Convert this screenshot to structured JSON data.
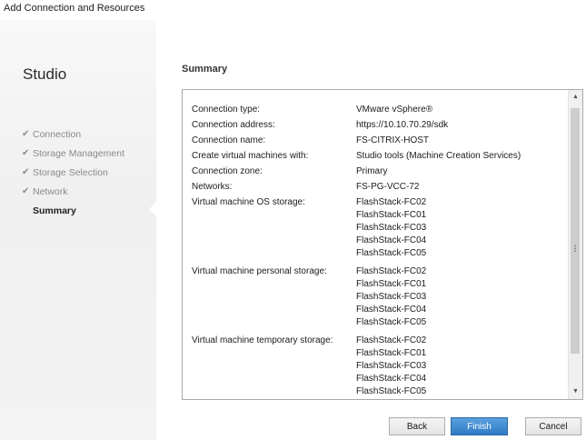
{
  "window": {
    "title": "Add Connection and Resources"
  },
  "sidebar": {
    "app_name": "Studio",
    "steps": [
      {
        "label": "Connection",
        "done": true
      },
      {
        "label": "Storage Management",
        "done": true
      },
      {
        "label": "Storage Selection",
        "done": true
      },
      {
        "label": "Network",
        "done": true
      },
      {
        "label": "Summary",
        "done": false,
        "active": true
      }
    ],
    "check_glyph": "✔"
  },
  "main": {
    "title": "Summary",
    "summary": {
      "connection_type": {
        "label": "Connection type:",
        "value": "VMware vSphere®"
      },
      "connection_address": {
        "label": "Connection address:",
        "value": "https://10.10.70.29/sdk"
      },
      "connection_name": {
        "label": "Connection name:",
        "value": "FS-CITRIX-HOST"
      },
      "create_vms": {
        "label": "Create virtual machines with:",
        "value": "Studio tools (Machine Creation Services)"
      },
      "connection_zone": {
        "label": "Connection zone:",
        "value": "Primary"
      },
      "networks": {
        "label": "Networks:",
        "value": "FS-PG-VCC-72"
      },
      "os_storage": {
        "label": "Virtual machine OS storage:",
        "values": [
          "FlashStack-FC02",
          "FlashStack-FC01",
          "FlashStack-FC03",
          "FlashStack-FC04",
          "FlashStack-FC05"
        ]
      },
      "personal_storage": {
        "label": "Virtual machine personal storage:",
        "values": [
          "FlashStack-FC02",
          "FlashStack-FC01",
          "FlashStack-FC03",
          "FlashStack-FC04",
          "FlashStack-FC05"
        ]
      },
      "temporary_storage": {
        "label": "Virtual machine temporary storage:",
        "values": [
          "FlashStack-FC02",
          "FlashStack-FC01",
          "FlashStack-FC03",
          "FlashStack-FC04",
          "FlashStack-FC05"
        ]
      }
    }
  },
  "buttons": {
    "back": "Back",
    "finish": "Finish",
    "cancel": "Cancel"
  },
  "colors": {
    "accent": "#2e7ac4",
    "sidebar_bg": "#f3f3f3"
  }
}
